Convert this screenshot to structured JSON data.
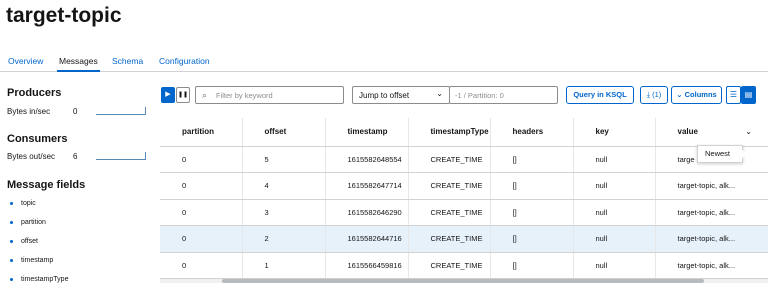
{
  "page_title": "target-topic",
  "tabs": [
    {
      "label": "Overview"
    },
    {
      "label": "Messages"
    },
    {
      "label": "Schema"
    },
    {
      "label": "Configuration"
    }
  ],
  "sidebar": {
    "producers_heading": "Producers",
    "bytes_in_label": "Bytes in/sec",
    "bytes_in_value": "0",
    "consumers_heading": "Consumers",
    "bytes_out_label": "Bytes out/sec",
    "bytes_out_value": "6",
    "fields_heading": "Message fields",
    "fields": [
      "topic",
      "partition",
      "offset",
      "timestamp",
      "timestampType"
    ]
  },
  "toolbar": {
    "play_icon": "▶",
    "pause_icon": "❚❚",
    "search_placeholder": "Filter by keyword",
    "jump_select_value": "Jump to offset",
    "partition_placeholder": "-1 / Partition: 0",
    "query_label": "Query in KSQL",
    "download_label": "(1)",
    "columns_label": "Columns"
  },
  "table": {
    "columns": [
      "partition",
      "offset",
      "timestamp",
      "timestampType",
      "headers",
      "key",
      "value"
    ],
    "rows": [
      [
        "0",
        "5",
        "1615582648554",
        "CREATE_TIME",
        "[]",
        "null",
        "target-topic, alk..."
      ],
      [
        "0",
        "4",
        "1615582647714",
        "CREATE_TIME",
        "[]",
        "null",
        "target-topic, alk..."
      ],
      [
        "0",
        "3",
        "1615582646290",
        "CREATE_TIME",
        "[]",
        "null",
        "target-topic, alk..."
      ],
      [
        "0",
        "2",
        "1615582644716",
        "CREATE_TIME",
        "[]",
        "null",
        "target-topic, alk..."
      ],
      [
        "0",
        "1",
        "1615566459816",
        "CREATE_TIME",
        "[]",
        "null",
        "target-topic, alk..."
      ]
    ],
    "first_row_value_visible": "targe",
    "selected_row_index": 3
  },
  "tooltip": "Newest",
  "colors": {
    "accent": "#0066cc",
    "selected_row": "#e7f1fa"
  }
}
